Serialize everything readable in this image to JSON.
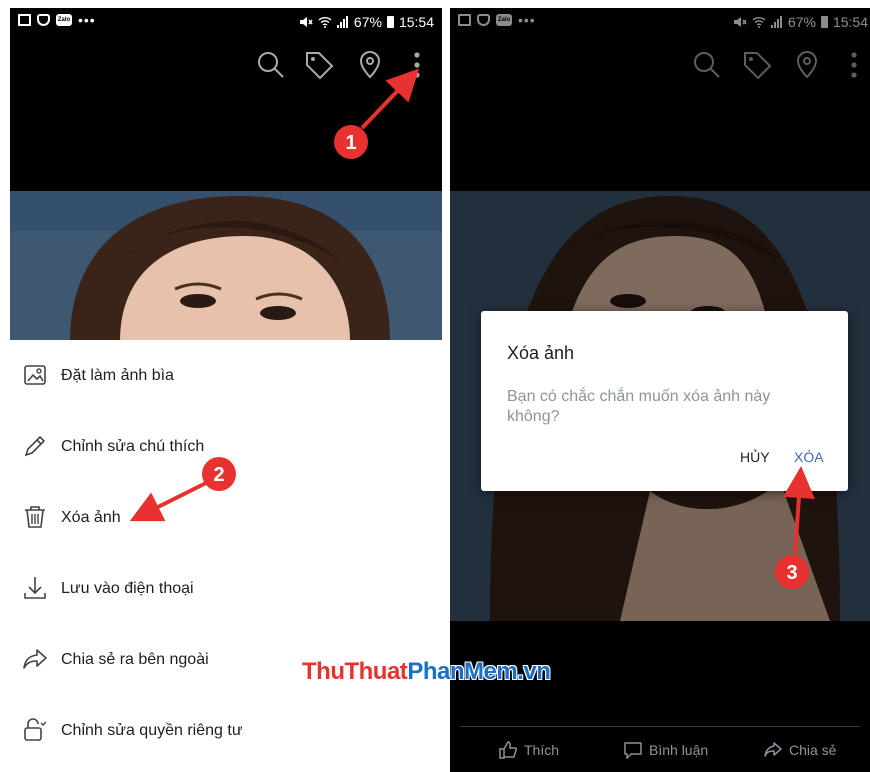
{
  "status_bar": {
    "left_panel": {
      "battery": "67%",
      "time": "15:54"
    },
    "right_panel": {
      "battery": "67%",
      "time": "15:54"
    }
  },
  "left_panel": {
    "toolbar_icons": [
      "search-icon",
      "tag-icon",
      "location-pin-icon",
      "more-vertical-icon"
    ],
    "menu": [
      {
        "label": "Đặt làm ảnh bìa",
        "icon": "cover-photo-icon"
      },
      {
        "label": "Chỉnh sửa chú thích",
        "icon": "pencil-icon"
      },
      {
        "label": "Xóa ảnh",
        "icon": "trash-icon"
      },
      {
        "label": "Lưu vào điện thoại",
        "icon": "download-icon"
      },
      {
        "label": "Chia sẻ ra bên ngoài",
        "icon": "share-icon"
      },
      {
        "label": "Chỉnh sửa quyền riêng tư",
        "icon": "lock-edit-icon"
      }
    ]
  },
  "right_panel": {
    "toolbar_icons": [
      "search-icon",
      "tag-icon",
      "location-pin-icon",
      "more-vertical-icon"
    ],
    "dialog": {
      "title": "Xóa ảnh",
      "message": "Bạn có chắc chắn muốn xóa ảnh này không?",
      "cancel_label": "HỦY",
      "confirm_label": "XÓA"
    },
    "bottom_bar": [
      {
        "label": "Thích",
        "icon": "like-icon"
      },
      {
        "label": "Bình luận",
        "icon": "comment-icon"
      },
      {
        "label": "Chia sẻ",
        "icon": "share-icon"
      }
    ]
  },
  "annotations": {
    "step_badges": [
      "1",
      "2",
      "3"
    ],
    "badge_color": "#e8322f"
  },
  "watermark": {
    "part1": "ThuThuat",
    "part2": "PhanMem",
    "part3": ".vn"
  },
  "colors": {
    "accent": "#4267b2",
    "text_primary": "#1c1e21",
    "text_secondary": "#8d949e"
  }
}
